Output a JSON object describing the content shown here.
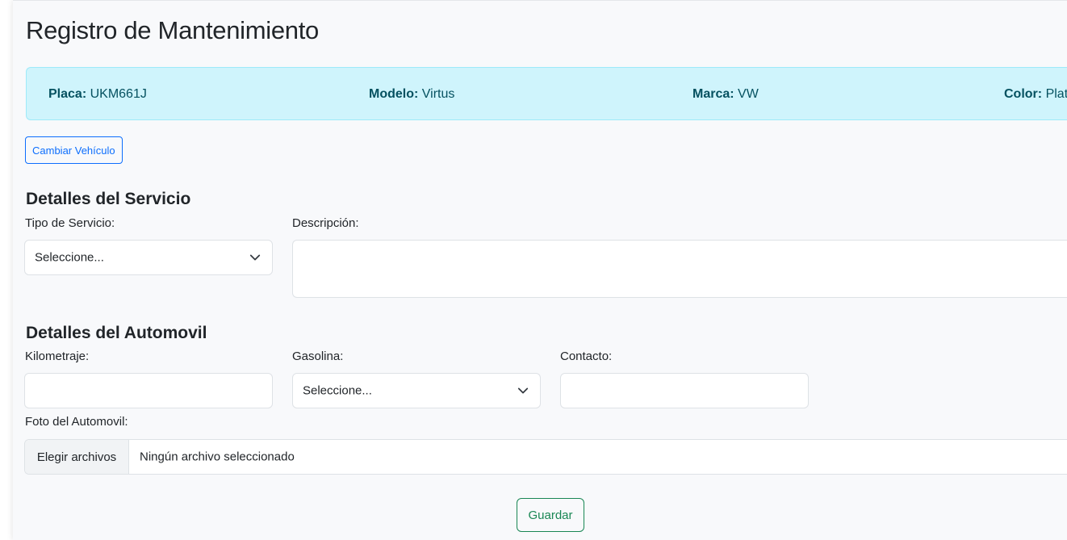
{
  "page": {
    "title": "Registro de Mantenimiento"
  },
  "vehicle": {
    "placa_label": "Placa:",
    "placa_value": "UKM661J",
    "modelo_label": "Modelo:",
    "modelo_value": "Virtus",
    "marca_label": "Marca:",
    "marca_value": "VW",
    "color_label": "Color:",
    "color_value": "Plata"
  },
  "actions": {
    "change_vehicle": "Cambiar Vehículo",
    "save": "Guardar"
  },
  "service": {
    "section_title": "Detalles del Servicio",
    "tipo_label": "Tipo de Servicio:",
    "tipo_value": "Seleccione...",
    "descripcion_label": "Descripción:",
    "descripcion_value": ""
  },
  "car": {
    "section_title": "Detalles del Automovil",
    "km_label": "Kilometraje:",
    "km_value": "",
    "gas_label": "Gasolina:",
    "gas_value": "Seleccione...",
    "contacto_label": "Contacto:",
    "contacto_value": "",
    "foto_label": "Foto del Automovil:",
    "file_button": "Elegir archivos",
    "file_status": "Ningún archivo seleccionado"
  },
  "icons": {
    "select_arrow": "chevron-down-icon"
  },
  "colors": {
    "info_bg": "#cff4fc",
    "info_text": "#055160",
    "primary": "#0d6efd",
    "success": "#198754"
  }
}
